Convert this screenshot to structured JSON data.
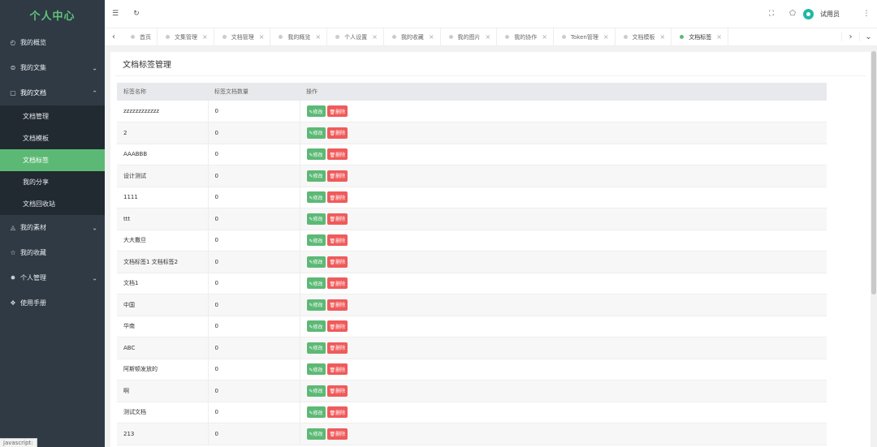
{
  "sidebar": {
    "brand": "个人中心",
    "items": [
      {
        "label": "我的概览",
        "icon": "gauge-icon"
      },
      {
        "label": "我的文集",
        "icon": "collection-icon"
      },
      {
        "label": "我的文档",
        "icon": "document-icon"
      },
      {
        "label": "我的素材",
        "icon": "image-icon"
      },
      {
        "label": "我的收藏",
        "icon": "star-icon"
      },
      {
        "label": "个人管理",
        "icon": "user-gear-icon"
      },
      {
        "label": "使用手册",
        "icon": "book-icon"
      }
    ],
    "submenu": [
      "文档管理",
      "文档模板",
      "文档标签",
      "我的分享",
      "文档回收站"
    ]
  },
  "status_bar": "javascript:",
  "header": {
    "user_name": "试用员"
  },
  "tabs": [
    "首页",
    "文集管理",
    "文档管理",
    "我的概览",
    "个人设置",
    "我的收藏",
    "我的图片",
    "我的协作",
    "Token管理",
    "文档模板",
    "文档标签"
  ],
  "page": {
    "title": "文档标签管理",
    "columns": [
      "标签名称",
      "标签文档数量",
      "操作"
    ],
    "edit_label": "✎修改",
    "delete_label": "🗑删除",
    "rows": [
      {
        "name": "zzzzzzzzzzzz",
        "count": "0"
      },
      {
        "name": "2",
        "count": "0"
      },
      {
        "name": "AAABBB",
        "count": "0"
      },
      {
        "name": "设计测试",
        "count": "0"
      },
      {
        "name": "1111",
        "count": "0"
      },
      {
        "name": "ttt",
        "count": "0"
      },
      {
        "name": "大大撒旦",
        "count": "0"
      },
      {
        "name": "文档标签1 文档标签2",
        "count": "0"
      },
      {
        "name": "文档1",
        "count": "0"
      },
      {
        "name": "中国",
        "count": "0"
      },
      {
        "name": "华南",
        "count": "0"
      },
      {
        "name": "ABC",
        "count": "0"
      },
      {
        "name": "阿斯顿发放的",
        "count": "0"
      },
      {
        "name": "啊",
        "count": "0"
      },
      {
        "name": "测试文档",
        "count": "0"
      },
      {
        "name": "213",
        "count": "0"
      }
    ]
  },
  "colors": {
    "sidebar_bg": "#2f3a45",
    "accent": "#5cb975",
    "danger": "#ef5b5b"
  }
}
